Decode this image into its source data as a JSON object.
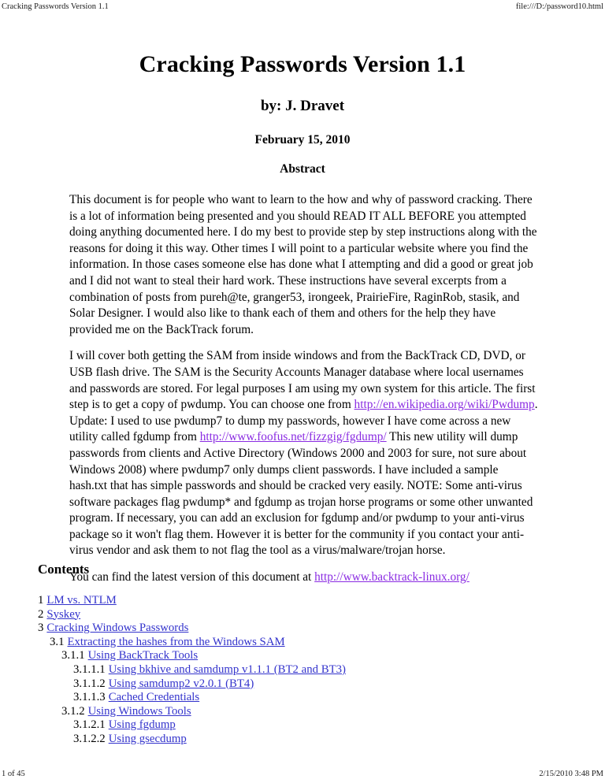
{
  "header": {
    "left": "Cracking Passwords Version 1.1",
    "right": "file:///D:/password10.html"
  },
  "footer": {
    "left": "1 of 45",
    "right": "2/15/2010 3:48 PM"
  },
  "document": {
    "title": "Cracking Passwords Version 1.1",
    "author": "by: J. Dravet",
    "date": "February 15, 2010",
    "abstract_heading": "Abstract"
  },
  "abstract": {
    "p1": "This document is for people who want to learn to the how and why of password cracking. There is a lot of information being presented and you should READ IT ALL BEFORE you attempted doing anything documented here. I do my best to provide step by step instructions along with the reasons for doing it this way. Other times I will point to a particular website where you find the information. In those cases someone else has done what I attempting and did a good or great job and I did not want to steal their hard work. These instructions have several excerpts from a combination of posts from pureh@te, granger53, irongeek, PrairieFire, RaginRob, stasik, and Solar Designer. I would also like to thank each of them and others for the help they have provided me on the BackTrack forum.",
    "p2_part1": "I will cover both getting the SAM from inside windows and from the BackTrack CD, DVD, or USB flash drive. The SAM is the Security Accounts Manager database where local usernames and passwords are stored. For legal purposes I am using my own system for this article. The first step is to get a copy of pwdump. You can choose one from ",
    "p2_link1": "http://en.wikipedia.org/wiki/Pwdump",
    "p2_part2": ". Update: I used to use pwdump7 to dump my passwords, however I have come across a new utility called fgdump from ",
    "p2_link2": "http://www.foofus.net/fizzgig/fgdump/",
    "p2_part3": " This new utility will dump passwords from clients and Active Directory (Windows 2000 and 2003 for sure, not sure about Windows 2008) where pwdump7 only dumps client passwords. I have included a sample hash.txt that has simple passwords and should be cracked very easily. NOTE: Some anti-virus software packages flag pwdump* and fgdump as trojan horse programs or some other unwanted program. If necessary, you can add an exclusion for fgdump and/or pwdump to your anti-virus package so it won't flag them. However it is better for the community if you contact your anti-virus vendor and ask them to not flag the tool as a virus/malware/trojan horse.",
    "p3_part1": "You can find the latest version of this document at ",
    "p3_link": "http://www.backtrack-linux.org/"
  },
  "contents": {
    "heading": "Contents",
    "items": [
      {
        "num": "1",
        "label": "LM vs. NTLM",
        "level": 1
      },
      {
        "num": "2",
        "label": "Syskey",
        "level": 1
      },
      {
        "num": "3",
        "label": "Cracking Windows Passwords",
        "level": 1
      },
      {
        "num": "3.1",
        "label": "Extracting the hashes from the Windows SAM",
        "level": 2
      },
      {
        "num": "3.1.1",
        "label": "Using BackTrack Tools",
        "level": 3
      },
      {
        "num": "3.1.1.1",
        "label": "Using bkhive and samdump v1.1.1 (BT2 and BT3)",
        "level": 4
      },
      {
        "num": "3.1.1.2",
        "label": "Using samdump2 v2.0.1 (BT4)",
        "level": 4
      },
      {
        "num": "3.1.1.3",
        "label": "Cached Credentials",
        "level": 4
      },
      {
        "num": "3.1.2",
        "label": "Using Windows Tools",
        "level": 3
      },
      {
        "num": "3.1.2.1",
        "label": "Using fgdump",
        "level": 4
      },
      {
        "num": "3.1.2.2",
        "label": "Using gsecdump",
        "level": 4
      }
    ]
  },
  "colors": {
    "visited_link": "#8a2be2",
    "toc_link": "#3333cc",
    "text": "#000000",
    "background": "#ffffff"
  }
}
